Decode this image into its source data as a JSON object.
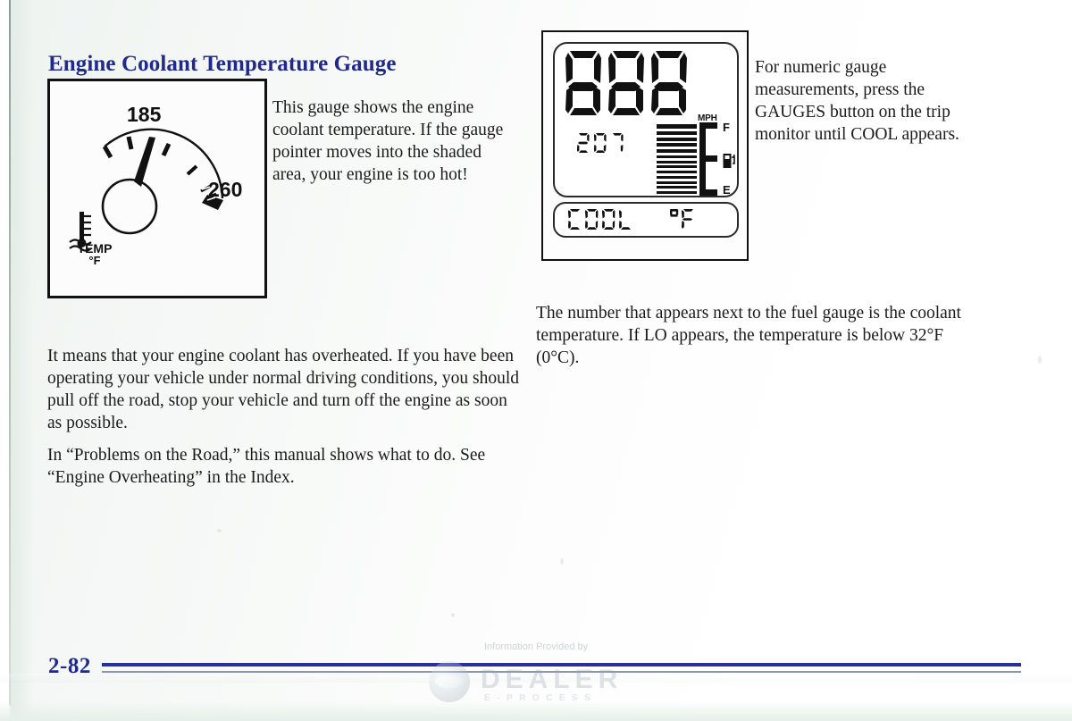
{
  "page": {
    "folio": "2-82",
    "section_title": "Engine Coolant Temperature Gauge",
    "title_color": "#202a8c",
    "rule_color": "#2a2f9e"
  },
  "analog_gauge": {
    "caption_paragraph": "This gauge shows the engine coolant temperature. If the gauge pointer moves into the shaded area, your engine is too hot!",
    "low_value": "185",
    "high_value": "260",
    "icon_label": "TEMP",
    "icon_unit": "°F",
    "thermometer_icon": "thermometer-coolant-icon"
  },
  "digital_cluster": {
    "speedometer_value": "000",
    "speedometer_unit": "MPH",
    "coolant_value": "207",
    "fuel_full_label": "F",
    "fuel_empty_label": "E",
    "fuel_pump_icon": "fuel-pump-icon",
    "fuel_bar_segments": 13,
    "fuel_filled_segments": 13,
    "message_label": "COOL",
    "message_unit": "°F",
    "caption_paragraph": "For numeric gauge measurements, press the GAUGES button on the trip monitor until COOL appears."
  },
  "body": {
    "paragraph_overheated": "It means that your engine coolant has overheated. If you have been operating your vehicle under normal driving conditions, you should pull off the road, stop your vehicle and turn off the engine as soon as possible.",
    "paragraph_index": "In “Problems on the Road,” this manual shows what to do. See “Engine Overheating” in the Index.",
    "paragraph_fuel_gauge_number": "The number that appears next to the fuel gauge is the coolant temperature. If LO appears, the temperature is below 32°F (0°C)."
  },
  "watermark": {
    "line1": "Information Provided by",
    "brand": "DEALER",
    "tagline": "E-PROCESS"
  }
}
